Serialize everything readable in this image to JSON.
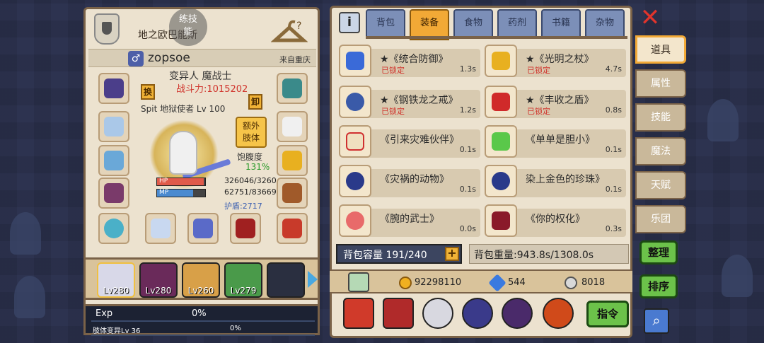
{
  "header": {
    "region": "地之欧巴能斯",
    "skill_bubble": "练技\n能"
  },
  "player": {
    "name": "zopsoe",
    "origin": "来自重庆",
    "title": "变异人 魔战士",
    "power": "战斗力:1015202",
    "pet_label": "Spit 地狱使者 Lv 100",
    "hp_label": "HP",
    "hp_value": "326046/3260",
    "hp_fraction": 0.97,
    "mp_label": "MP",
    "mp_value": "62751/83669",
    "mp_fraction": 0.75,
    "shield": "护盾:2717",
    "hunger_label": "饱腹度",
    "hunger_value": "131%"
  },
  "buttons": {
    "swap": "换",
    "unequip": "卸",
    "extra_limb": "额外\n肢体"
  },
  "party": [
    {
      "level": "Lv280"
    },
    {
      "level": "Lv280"
    },
    {
      "level": "Lv260"
    },
    {
      "level": "Lv279"
    },
    {
      "level": ""
    }
  ],
  "exp": {
    "label": "Exp",
    "percent": "0%",
    "body_label": "肢体变异Lv 36",
    "body_percent": "0%"
  },
  "tabs": [
    {
      "label": "背包"
    },
    {
      "label": "装备"
    },
    {
      "label": "食物"
    },
    {
      "label": "药剂"
    },
    {
      "label": "书籍"
    },
    {
      "label": "杂物"
    }
  ],
  "items": [
    {
      "name": "★《统合防御》",
      "lock": "已锁定",
      "cd": "1.3s"
    },
    {
      "name": "★《光明之杖》",
      "lock": "已锁定",
      "cd": "4.7s"
    },
    {
      "name": "★《钢铁龙之戒》",
      "lock": "已锁定",
      "cd": "1.2s"
    },
    {
      "name": "★《丰收之盾》",
      "lock": "已锁定",
      "cd": "0.8s"
    },
    {
      "name": "《引来灾难伙伴》",
      "lock": "",
      "cd": "0.1s"
    },
    {
      "name": "《单单是胆小》",
      "lock": "",
      "cd": "0.1s"
    },
    {
      "name": "《灾祸的动物》",
      "lock": "",
      "cd": "0.1s"
    },
    {
      "name": "染上金色的珍珠》",
      "lock": "",
      "cd": "0.1s"
    },
    {
      "name": "《腕的武士》",
      "lock": "",
      "cd": "0.0s"
    },
    {
      "name": "《你的权化》",
      "lock": "",
      "cd": "0.3s"
    }
  ],
  "inventory": {
    "capacity": "背包容量 191/240",
    "weight": "背包重量:943.8s/1308.0s"
  },
  "currency": {
    "gold": "92298110",
    "diamond": "544",
    "silver": "8018"
  },
  "actions": {
    "command": "指令"
  },
  "side_nav": [
    {
      "label": "道具"
    },
    {
      "label": "属性"
    },
    {
      "label": "技能"
    },
    {
      "label": "魔法"
    },
    {
      "label": "天赋"
    },
    {
      "label": "乐团"
    }
  ],
  "side_actions": {
    "sort_label": "整理",
    "order_label": "排序"
  },
  "colors": {
    "accent": "#f2a936",
    "danger": "#d0342c",
    "panel": "#ece2cf",
    "green_button": "#6cc24a"
  }
}
